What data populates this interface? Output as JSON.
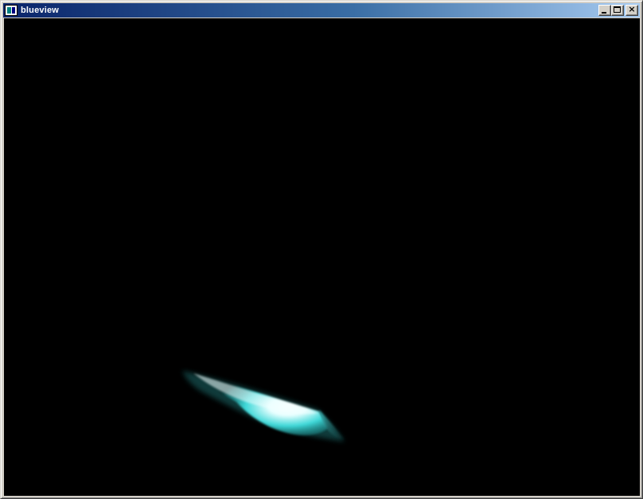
{
  "window": {
    "title": "blueview",
    "minimize_icon": "minimize-icon",
    "maximize_icon": "maximize-icon",
    "close_icon": "close-icon",
    "close_glyph": "×"
  },
  "viewport": {
    "background_color": "#000000",
    "rendered_object_color": "#40e0e0",
    "highlight_color": "#ffffff"
  }
}
